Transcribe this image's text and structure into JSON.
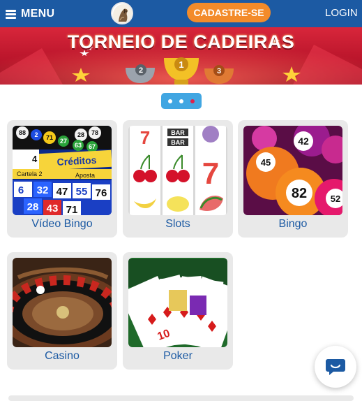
{
  "header": {
    "menu_label": "MENU",
    "cta_label": "CADASTRE-SE",
    "login_label": "LOGIN"
  },
  "banner": {
    "title": "TORNEIO DE CADEIRAS",
    "trophies": [
      "2",
      "1",
      "3"
    ]
  },
  "carousel": {
    "slide_count": 3,
    "active_index": 2
  },
  "games": [
    {
      "label": "Vídeo Bingo",
      "thumb_text": [
        "Créditos",
        "Cartela",
        "Aposta",
        "2"
      ],
      "numbers": [
        "88",
        "2",
        "71",
        "28",
        "78",
        "27",
        "63",
        "67",
        "4",
        "6",
        "32",
        "47",
        "55",
        "76",
        "28",
        "43",
        "71",
        "1"
      ]
    },
    {
      "label": "Slots",
      "thumb_text": [
        "BAR",
        "BAR",
        "7",
        "7"
      ]
    },
    {
      "label": "Bingo",
      "thumb_text": [
        "42",
        "82",
        "52",
        "42"
      ]
    },
    {
      "label": "Casino"
    },
    {
      "label": "Poker",
      "thumb_text": [
        "10"
      ]
    }
  ],
  "colors": {
    "header": "#1c5aa3",
    "cta": "#f38b2a",
    "dots_bg": "#41a6e2",
    "dot_active": "#e0204a",
    "card_bg": "#e9e9e9",
    "label": "#1c5aa3"
  },
  "icons": {
    "menu": "hamburger-icon",
    "logo": "horse-logo-icon",
    "chat": "chat-bubble-icon"
  }
}
